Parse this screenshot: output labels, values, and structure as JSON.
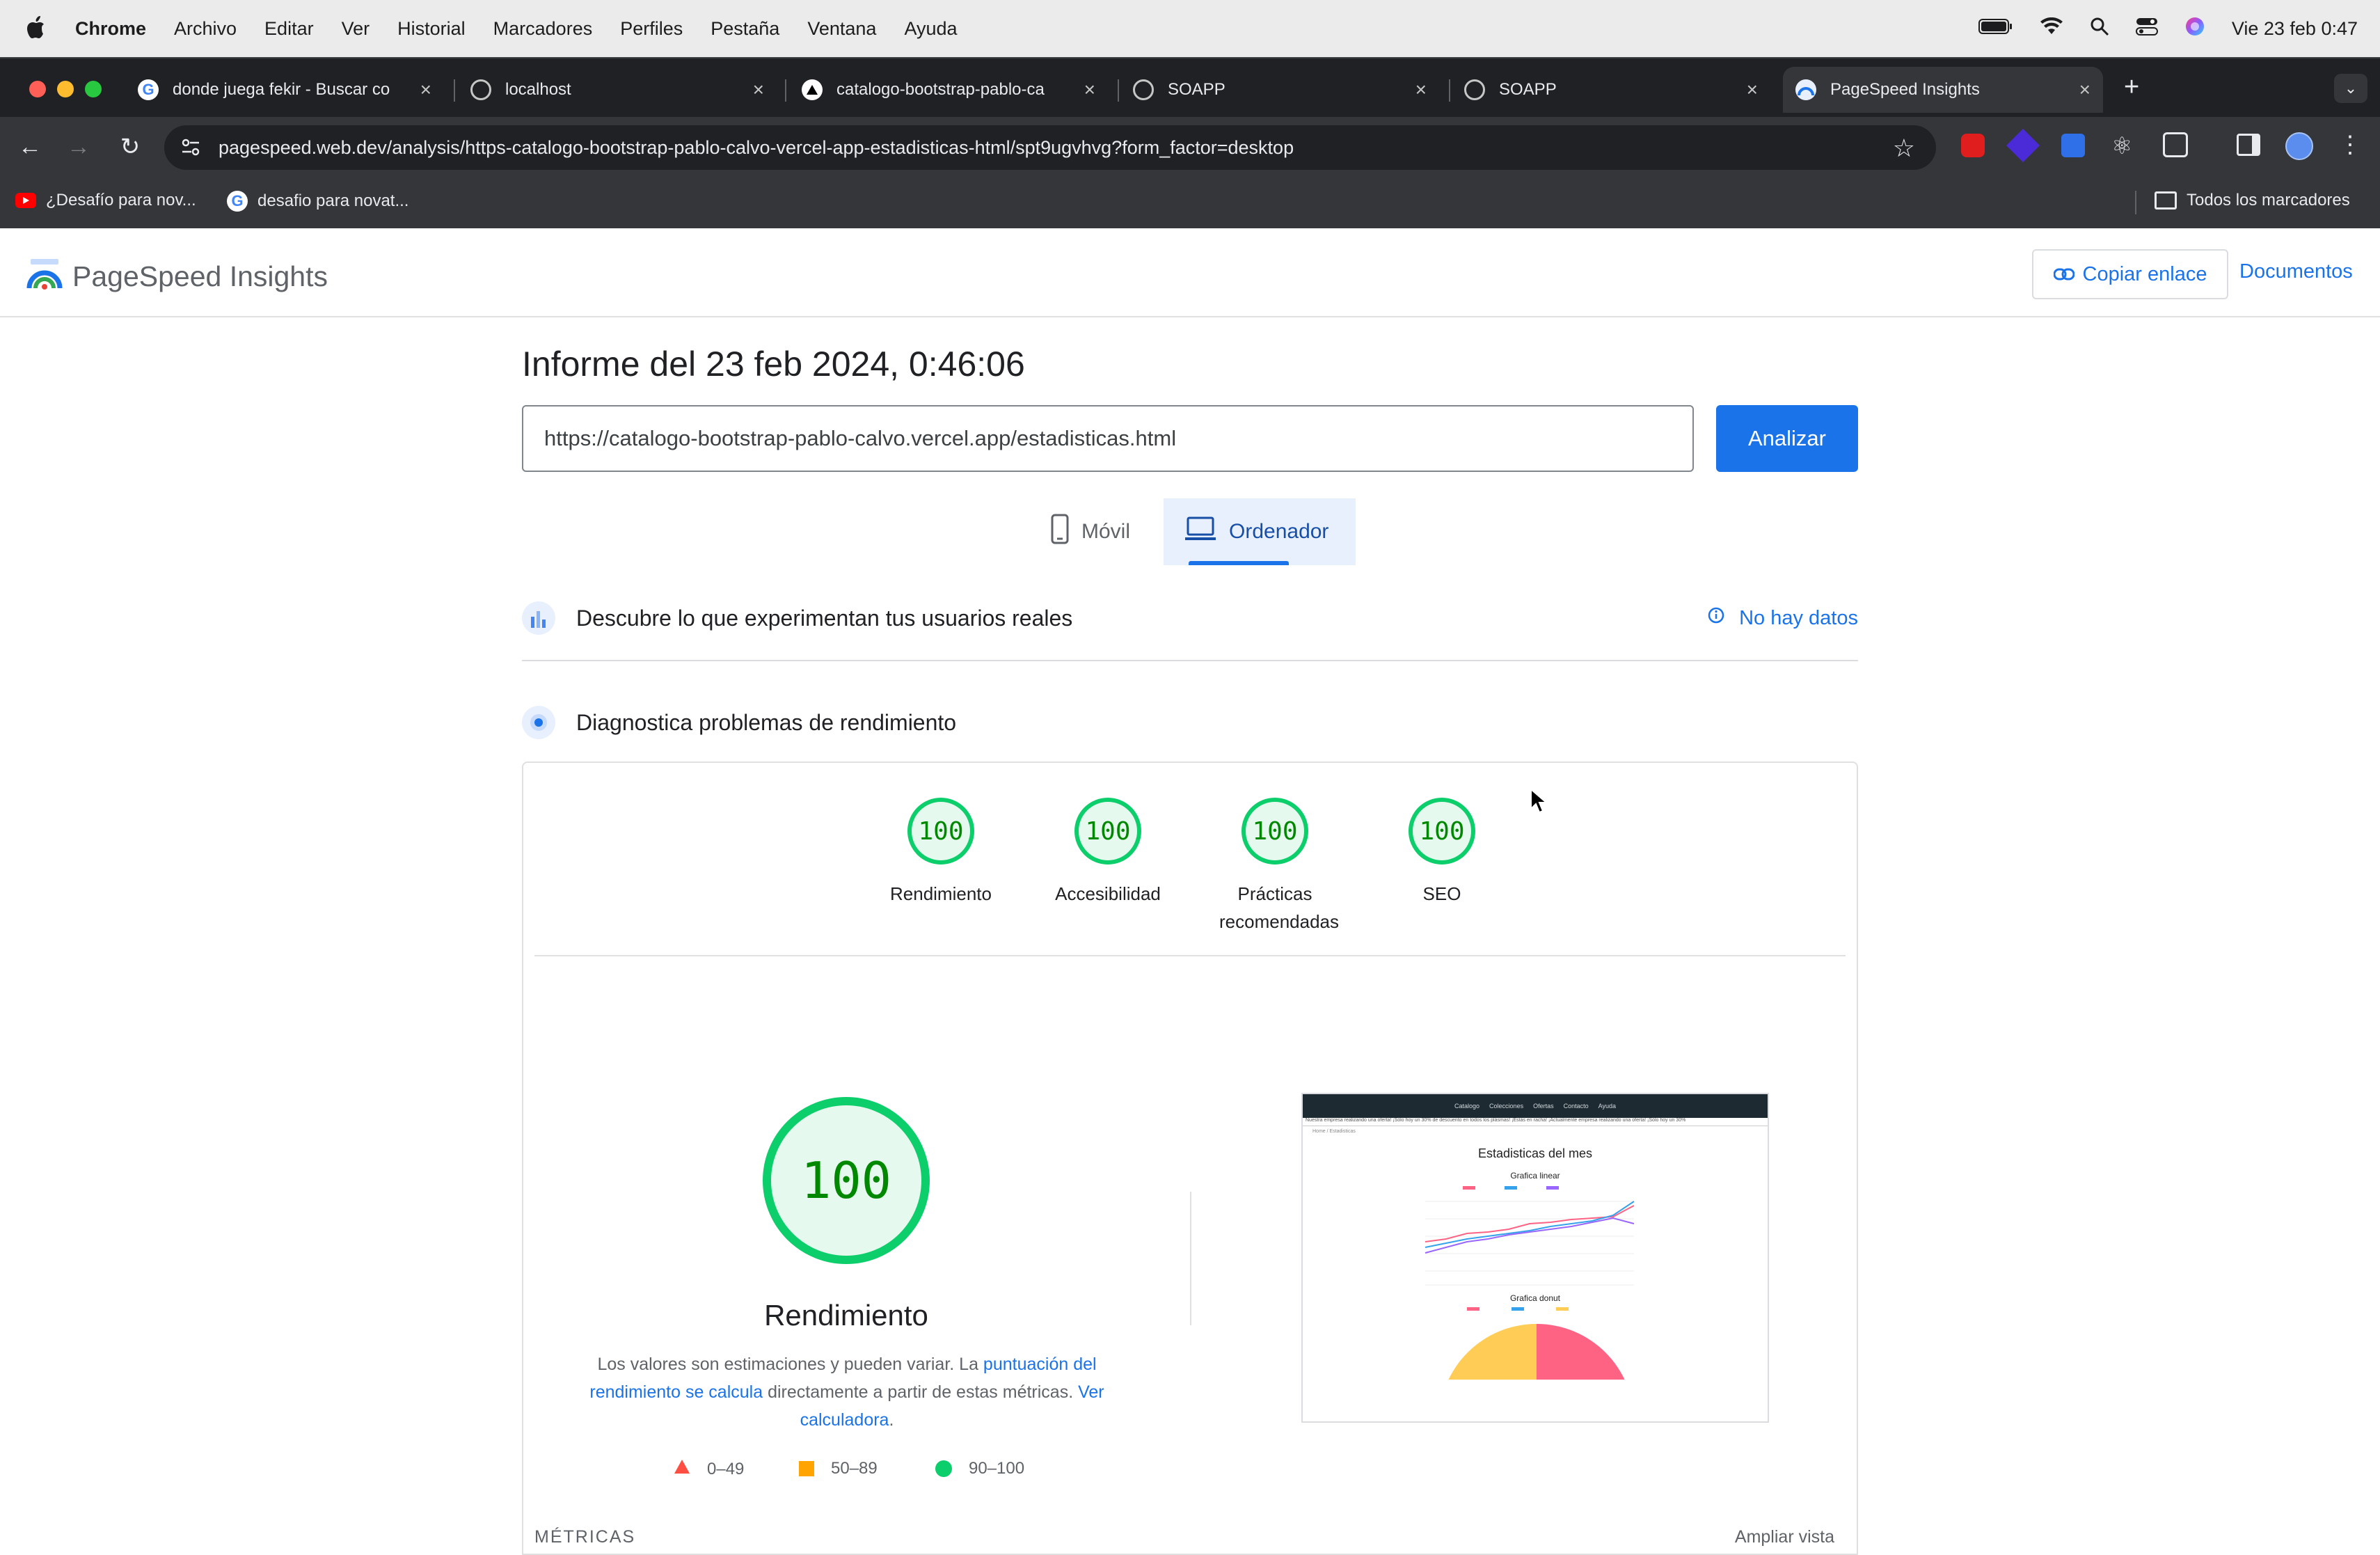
{
  "menubar": {
    "app": "Chrome",
    "items": [
      "Archivo",
      "Editar",
      "Ver",
      "Historial",
      "Marcadores",
      "Perfiles",
      "Pestaña",
      "Ventana",
      "Ayuda"
    ],
    "clock": "Vie 23 feb 0:47"
  },
  "tabs": [
    {
      "title": "donde juega fekir - Buscar co",
      "icon": "google-icon"
    },
    {
      "title": "localhost",
      "icon": "globe-icon"
    },
    {
      "title": "catalogo-bootstrap-pablo-ca",
      "icon": "vercel-icon"
    },
    {
      "title": "SOAPP",
      "icon": "globe-icon"
    },
    {
      "title": "SOAPP",
      "icon": "globe-icon"
    },
    {
      "title": "PageSpeed Insights",
      "icon": "pagespeed-icon"
    }
  ],
  "address": {
    "url": "pagespeed.web.dev/analysis/https-catalogo-bootstrap-pablo-calvo-vercel-app-estadisticas-html/spt9ugvhvg?form_factor=desktop"
  },
  "bookmarks": {
    "items": [
      "¿Desafío para nov...",
      "desafio para novat..."
    ],
    "all": "Todos los marcadores"
  },
  "header": {
    "logo_text": "PageSpeed Insights",
    "copy_link": "Copiar enlace",
    "docs": "Documentos"
  },
  "report": {
    "title": "Informe del 23 feb 2024, 0:46:06",
    "url_value": "https://catalogo-bootstrap-pablo-calvo.vercel.app/estadisticas.html",
    "analyze": "Analizar",
    "mobile": "Móvil",
    "desktop": "Ordenador"
  },
  "field_data": {
    "label": "Descubre lo que experimentan tus usuarios reales",
    "no_data": "No hay datos"
  },
  "diagnose": {
    "label": "Diagnostica problemas de rendimiento"
  },
  "scores": [
    {
      "value": "100",
      "label": "Rendimiento"
    },
    {
      "value": "100",
      "label": "Accesibilidad"
    },
    {
      "value": "100",
      "label": "Prácticas recomendadas"
    },
    {
      "value": "100",
      "label": "SEO"
    }
  ],
  "performance": {
    "score": "100",
    "title": "Rendimiento",
    "desc_1": "Los valores son estimaciones y pueden variar. La ",
    "desc_link_1": "puntuación del rendimiento se calcula",
    "desc_2": " directamente a partir de estas métricas. ",
    "desc_link_2": "Ver calculadora",
    "desc_3": ".",
    "legend": [
      "0–49",
      "50–89",
      "90–100"
    ],
    "metrics_label": "MÉTRICAS",
    "expand": "Ampliar vista"
  },
  "screenshot": {
    "nav_items": [
      "Catalogo",
      "Colecciones",
      "Ofertas",
      "Contacto",
      "Ayuda"
    ],
    "marquee": "Nuestra empresa realizando una oferta! ¡Sólo hoy un 30% de descuento en todos los plásmas! ¡Estás en racha! ¡Actualmente empresa realizando una oferta! ¡Sólo hoy un 30%",
    "crumb": "Home / Estadisticas",
    "heading": "Estadisticas del mes",
    "line_title": "Grafica linear",
    "donut_title": "Grafica donut"
  },
  "colors": {
    "accent": "#1a73e8",
    "pass": "#0cce6b",
    "average": "#ffa400",
    "fail": "#ff4e42"
  }
}
